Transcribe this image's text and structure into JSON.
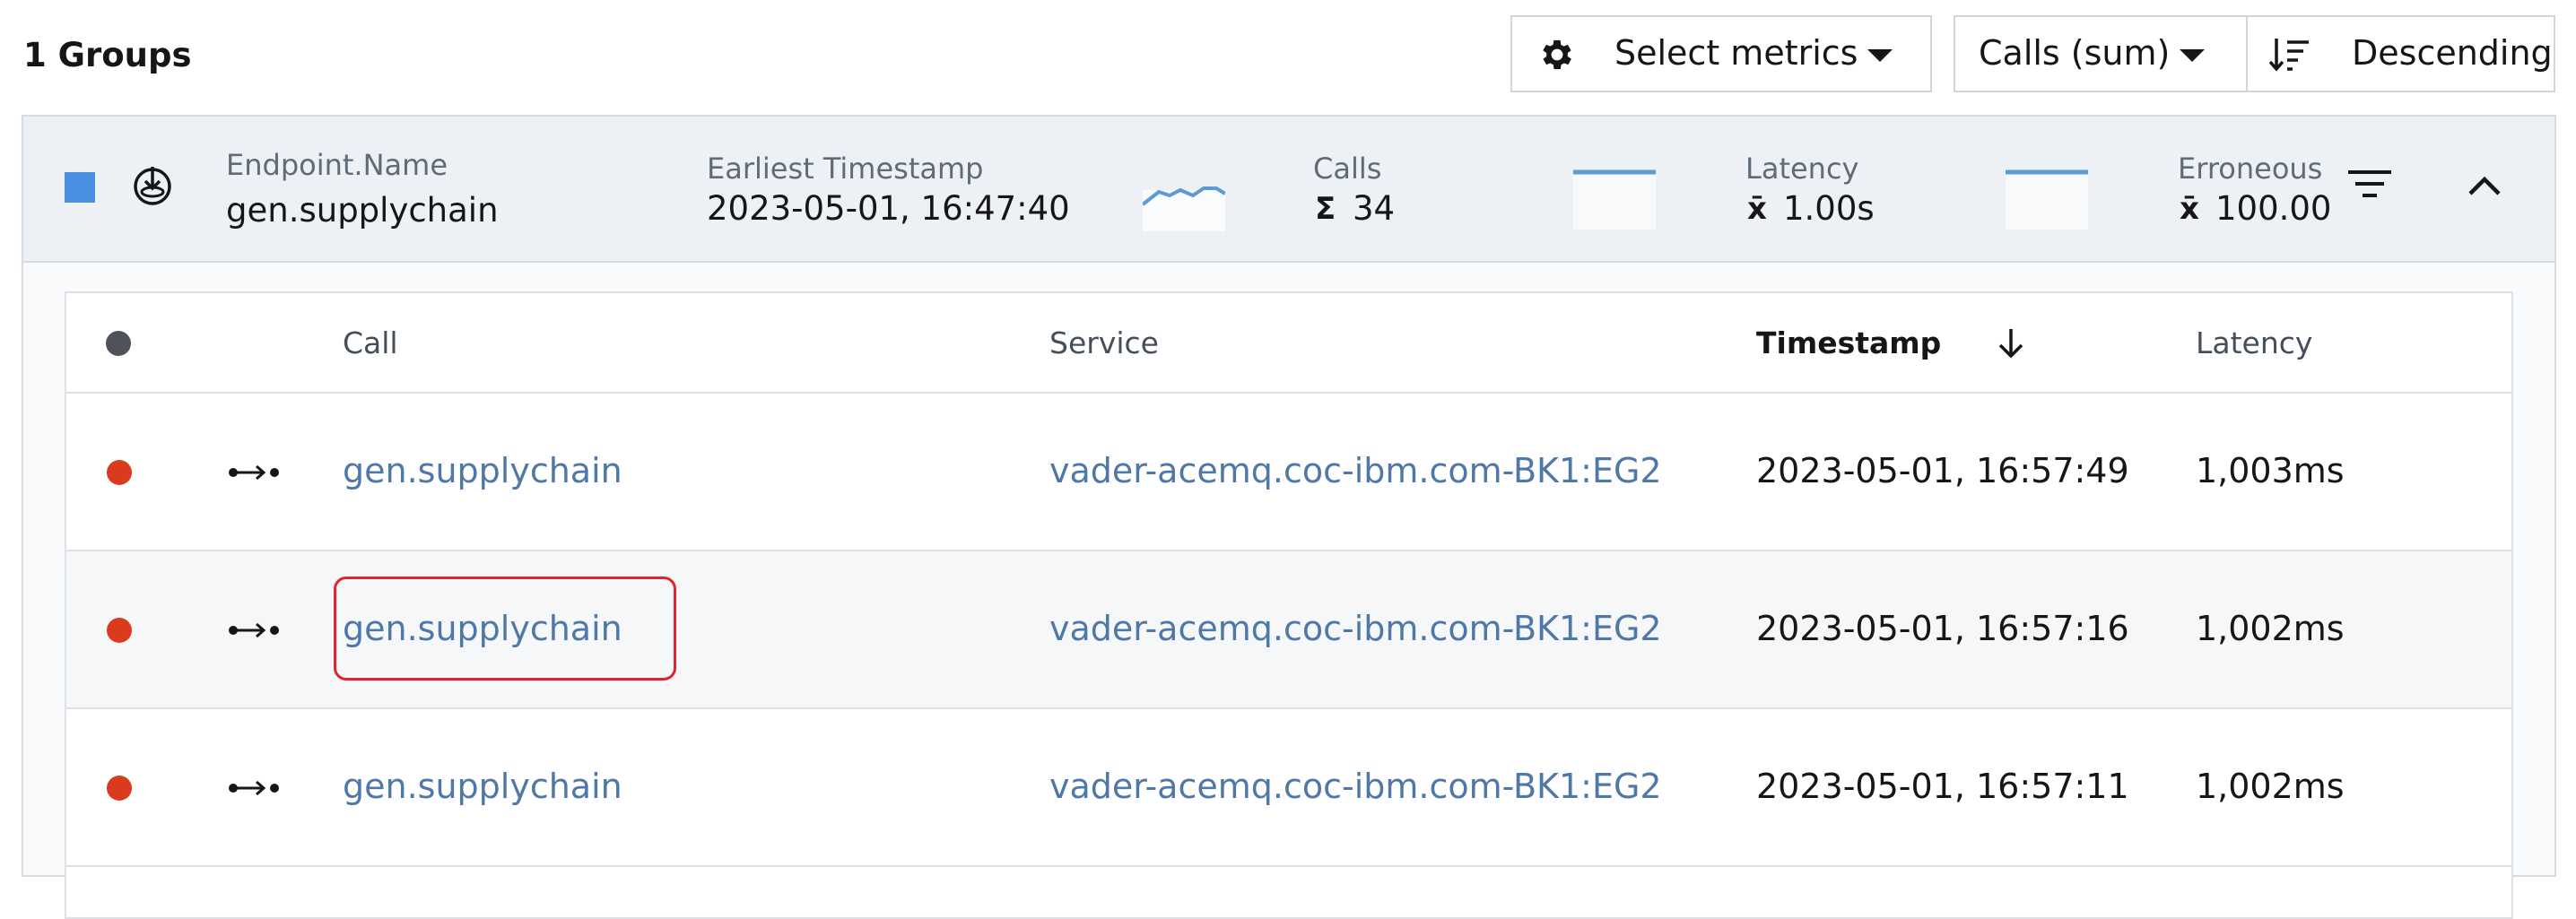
{
  "toolbar": {
    "title": "1 Groups",
    "select_metrics_label": "Select metrics",
    "sort_metric_label": "Calls (sum)",
    "sort_order_label": "Descending",
    "icons": {
      "metrics": "gear-icon",
      "order": "sort-descending-icon"
    }
  },
  "group": {
    "color": "#4a90e2",
    "icon": "endpoint-icon",
    "name_label": "Endpoint.Name",
    "name_value": "gen.supplychain",
    "earliest_label": "Earliest Timestamp",
    "earliest_value": "2023-05-01, 16:47:40",
    "calls_label": "Calls",
    "calls_agg": "Σ",
    "calls_value": "34",
    "latency_label": "Latency",
    "latency_agg": "x̄",
    "latency_value": "1.00s",
    "erroneous_label": "Erroneous",
    "erroneous_agg": "x̄",
    "erroneous_value": "100.00"
  },
  "table": {
    "headers": {
      "status": "",
      "call": "Call",
      "service": "Service",
      "timestamp": "Timestamp",
      "latency": "Latency"
    },
    "sort_column": "timestamp",
    "rows": [
      {
        "call": "gen.supplychain",
        "service": "vader-acemq.coc-ibm.com-BK1:EG2",
        "timestamp": "2023-05-01, 16:57:49",
        "latency": "1,003ms"
      },
      {
        "call": "gen.supplychain",
        "service": "vader-acemq.coc-ibm.com-BK1:EG2",
        "timestamp": "2023-05-01, 16:57:16",
        "latency": "1,002ms"
      },
      {
        "call": "gen.supplychain",
        "service": "vader-acemq.coc-ibm.com-BK1:EG2",
        "timestamp": "2023-05-01, 16:57:11",
        "latency": "1,002ms"
      }
    ]
  },
  "colors": {
    "error": "#da3b1d",
    "link": "#4f78a8",
    "highlight": "#e0232e",
    "sparkline": "#5b9bd5"
  }
}
